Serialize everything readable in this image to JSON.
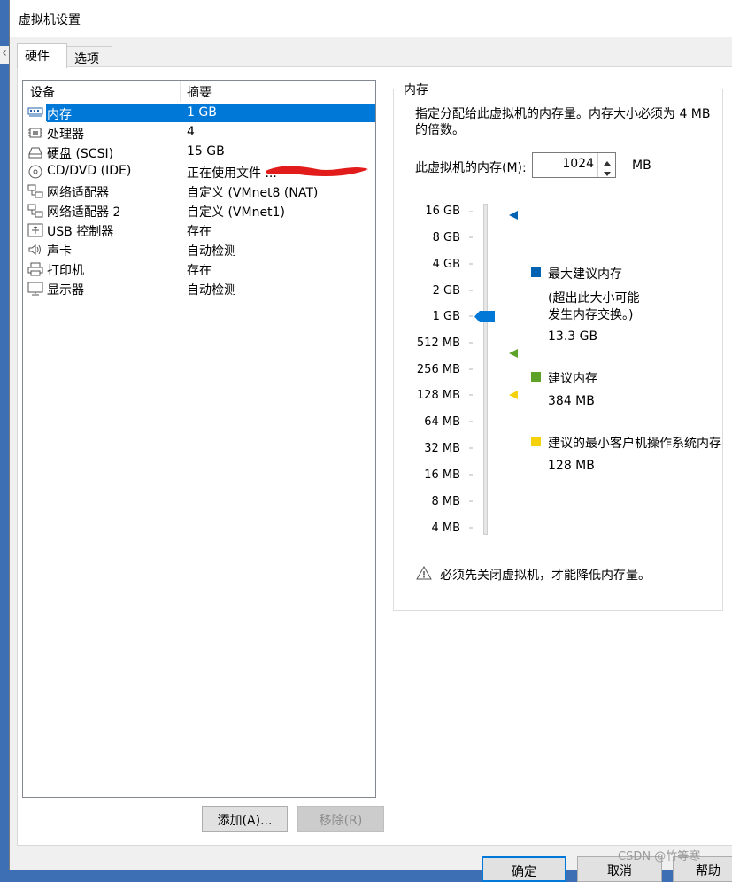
{
  "window": {
    "title": "虚拟机设置"
  },
  "tabs": [
    {
      "label": "硬件",
      "active": true
    },
    {
      "label": "选项",
      "active": false
    }
  ],
  "devices": {
    "headers": {
      "device": "设备",
      "summary": "摘要"
    },
    "rows": [
      {
        "name": "内存",
        "summary": "1 GB",
        "icon": "memory-icon",
        "selected": true
      },
      {
        "name": "处理器",
        "summary": "4",
        "icon": "cpu-icon"
      },
      {
        "name": "硬盘 (SCSI)",
        "summary": "15 GB",
        "icon": "harddisk-icon"
      },
      {
        "name": "CD/DVD (IDE)",
        "summary": "正在使用文件 ...",
        "icon": "cd-dvd-icon"
      },
      {
        "name": "网络适配器",
        "summary": "自定义 (VMnet8 (NAT)",
        "icon": "network-icon"
      },
      {
        "name": "网络适配器 2",
        "summary": "自定义 (VMnet1)",
        "icon": "network-icon"
      },
      {
        "name": "USB 控制器",
        "summary": "存在",
        "icon": "usb-icon"
      },
      {
        "name": "声卡",
        "summary": "自动检测",
        "icon": "speaker-icon"
      },
      {
        "name": "打印机",
        "summary": "存在",
        "icon": "printer-icon"
      },
      {
        "name": "显示器",
        "summary": "自动检测",
        "icon": "monitor-icon"
      }
    ],
    "add_button": "添加(A)...",
    "remove_button": "移除(R)"
  },
  "memory": {
    "group_title": "内存",
    "description_line1": "指定分配给此虚拟机的内存量。内存大小必须为 4 MB",
    "description_line2": "的倍数。",
    "field_label": "此虚拟机的内存(M):",
    "field_value": "1024",
    "field_unit": "MB",
    "scale_labels": [
      "16 GB",
      "8 GB",
      "4 GB",
      "2 GB",
      "1 GB",
      "512 MB",
      "256 MB",
      "128 MB",
      "64 MB",
      "32 MB",
      "16 MB",
      "8 MB",
      "4 MB"
    ],
    "current_value_label": "1 GB",
    "max_title": "最大建议内存",
    "max_note_line1": "(超出此大小可能",
    "max_note_line2": "发生内存交换。)",
    "max_value": "13.3 GB",
    "rec_title": "建议内存",
    "rec_value": "384 MB",
    "min_title": "建议的最小客户机操作系统内存",
    "min_value": "128 MB",
    "warning": "必须先关闭虚拟机，才能降低内存量。",
    "colors": {
      "max": "#0063b1",
      "recommended": "#5ea227",
      "minimum": "#f4d10a",
      "selection": "#0078d7"
    }
  },
  "footer": {
    "ok": "确定",
    "cancel": "取消",
    "help": "帮助"
  },
  "watermark": "CSDN @竹等寒"
}
